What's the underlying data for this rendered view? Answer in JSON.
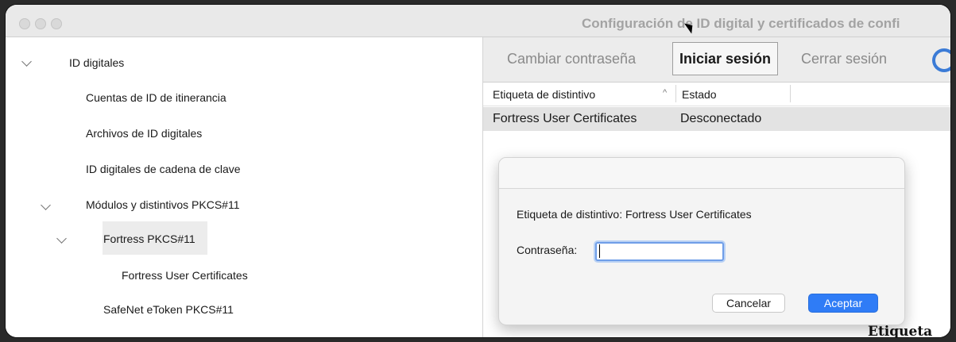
{
  "window": {
    "title": "Configuración de ID digital y certificados de confi"
  },
  "tree": {
    "items": [
      {
        "label": "ID digitales",
        "expanded": true
      },
      {
        "label": "Cuentas de ID de itinerancia"
      },
      {
        "label": "Archivos de ID digitales"
      },
      {
        "label": "ID digitales de cadena de clave"
      },
      {
        "label": "Módulos y distintivos PKCS#11",
        "expanded": true
      },
      {
        "label": "Fortress PKCS#11",
        "expanded": true,
        "selected": true
      },
      {
        "label": "Fortress User Certificates"
      },
      {
        "label": "SafeNet eToken PKCS#11"
      }
    ]
  },
  "toolbar": {
    "change_password": "Cambiar contraseña",
    "login": "Iniciar sesión",
    "logout": "Cerrar sesión",
    "refresh_icon": "refresh-icon"
  },
  "table": {
    "columns": [
      "Etiqueta de distintivo",
      "Estado"
    ],
    "sort_indicator": "^",
    "rows": [
      {
        "label": "Fortress User Certificates",
        "status": "Desconectado"
      }
    ]
  },
  "dialog": {
    "token_label": "Etiqueta de distintivo: Fortress User Certificates",
    "password_label": "Contraseña:",
    "password_value": "",
    "cancel": "Cancelar",
    "accept": "Aceptar",
    "accent_color": "#2f7cf6"
  },
  "background_text": "Etiqueta"
}
